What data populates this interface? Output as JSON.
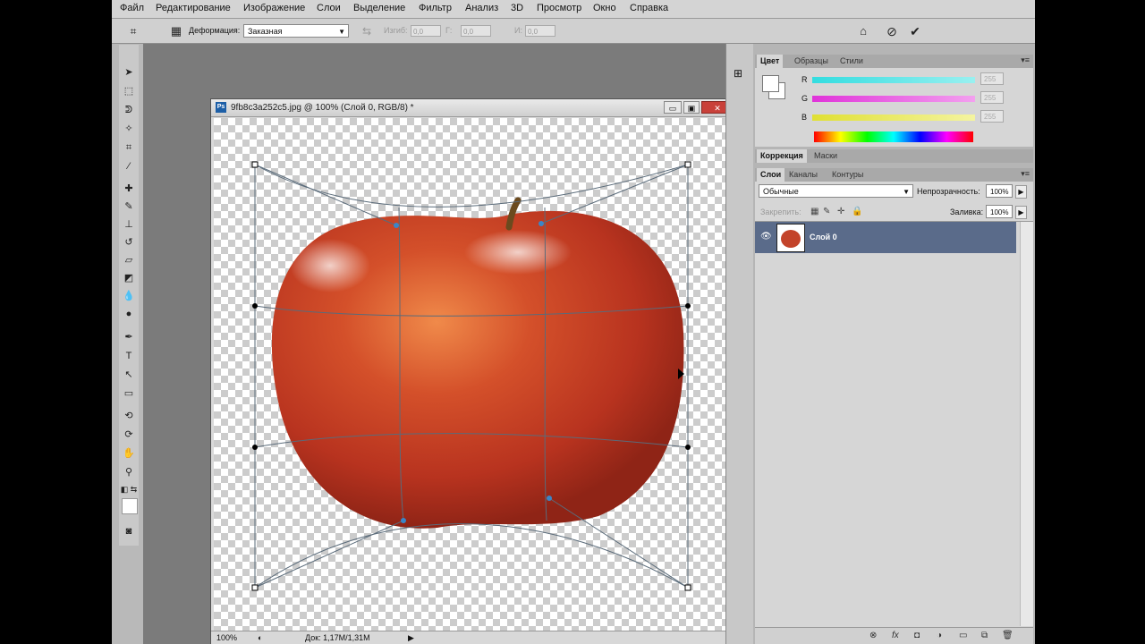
{
  "menu": [
    "Файл",
    "Редактирование",
    "Изображение",
    "Слои",
    "Выделение",
    "Фильтр",
    "Анализ",
    "3D",
    "Просмотр",
    "Окно",
    "Справка"
  ],
  "options": {
    "warp_label": "Деформация:",
    "warp_value": "Заказная",
    "bend_label": "Изгиб:",
    "bend_value": "0,0",
    "h_label": "Г:",
    "h_value": "0,0",
    "v_label": "И:",
    "v_value": "0,0"
  },
  "document": {
    "title": "9fb8c3a252c5.jpg @ 100% (Слой 0, RGB/8) *",
    "zoom": "100%",
    "doc_info": "Док: 1,17M/1,31M"
  },
  "color_panel": {
    "tabs": [
      "Цвет",
      "Образцы",
      "Стили"
    ],
    "labels": [
      "R",
      "G",
      "B"
    ],
    "values": [
      "255",
      "255",
      "255"
    ],
    "accent_cyan": "#33dde0",
    "accent_magenta": "#e033d9",
    "accent_yellow": "#e0e033"
  },
  "adjust_panel": {
    "tabs": [
      "Коррекция",
      "Маски"
    ]
  },
  "layers_panel": {
    "tabs": [
      "Слои",
      "Каналы",
      "Контуры"
    ],
    "blend_mode": "Обычные",
    "opacity_label": "Непрозрачность:",
    "opacity_value": "100%",
    "lock_label": "Закрепить:",
    "fill_label": "Заливка:",
    "fill_value": "100%",
    "layer_name": "Слой 0",
    "selected_color": "#5a6b8a"
  }
}
